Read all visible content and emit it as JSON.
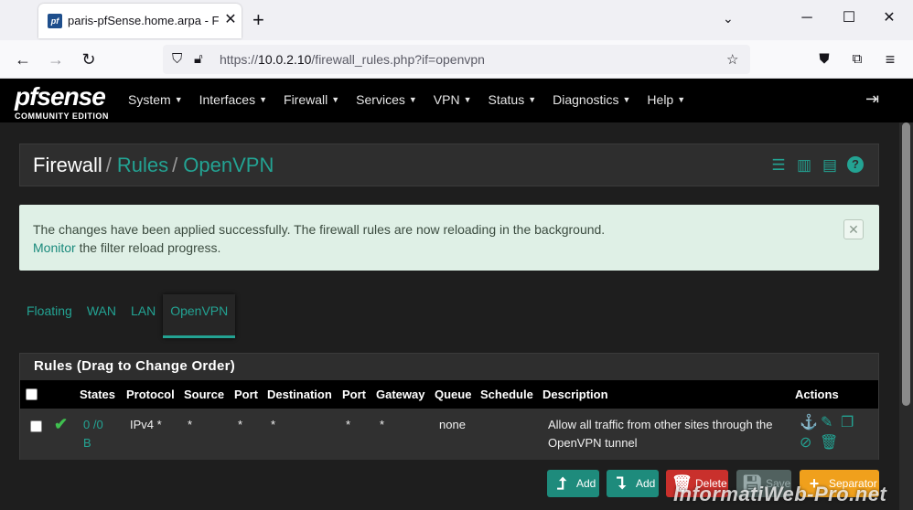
{
  "browser": {
    "tab_title": "paris-pfSense.home.arpa - Firewall",
    "tab_favicon": "pf",
    "url_prefix": "https://",
    "url_host": "10.0.2.10",
    "url_path": "/firewall_rules.php?if=openvpn"
  },
  "pfsense": {
    "logo_main": "pfsense",
    "logo_sub": "COMMUNITY EDITION",
    "menu": [
      "System",
      "Interfaces",
      "Firewall",
      "Services",
      "VPN",
      "Status",
      "Diagnostics",
      "Help"
    ]
  },
  "breadcrumb": {
    "first": "Firewall",
    "second": "Rules",
    "third": "OpenVPN",
    "sep": "/"
  },
  "alert": {
    "line1": "The changes have been applied successfully. The firewall rules are now reloading in the background.",
    "link": "Monitor",
    "line2_rest": " the filter reload progress."
  },
  "tabs": [
    "Floating",
    "WAN",
    "LAN",
    "OpenVPN"
  ],
  "active_tab": "OpenVPN",
  "rules": {
    "heading": "Rules (Drag to Change Order)",
    "columns": {
      "states": "States",
      "protocol": "Protocol",
      "source": "Source",
      "port1": "Port",
      "destination": "Destination",
      "port2": "Port",
      "gateway": "Gateway",
      "queue": "Queue",
      "schedule": "Schedule",
      "description": "Description",
      "actions": "Actions"
    },
    "rows": [
      {
        "states_line1": "0 /0",
        "states_line2": "B",
        "protocol": "IPv4 *",
        "source": "*",
        "port1": "*",
        "destination": "*",
        "port2": "*",
        "gateway": "*",
        "queue": "none",
        "schedule": "",
        "description": "Allow all traffic from other sites through the OpenVPN tunnel"
      }
    ]
  },
  "buttons": {
    "add_top": "Add",
    "add_bottom": "Add",
    "delete": "Delete",
    "save": "Save",
    "separator": "Separator"
  },
  "watermark": "InformatiWeb-Pro.net",
  "colors": {
    "accent": "#23a393",
    "alert_bg": "#dff0e6",
    "delete": "#c9302c",
    "separator": "#f0a01c"
  }
}
